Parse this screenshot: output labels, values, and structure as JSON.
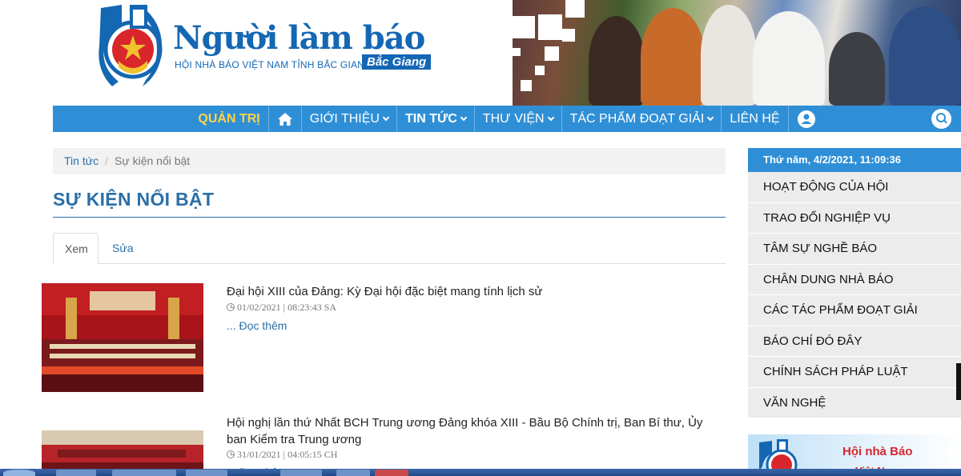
{
  "header": {
    "logo_title": "Người làm báo",
    "logo_subtitle": "HỘI NHÀ BÁO VIỆT NAM TỈNH BẮC GIANG",
    "logo_badge": "Bắc Giang"
  },
  "nav": {
    "admin": "QUẢN TRỊ",
    "items": [
      {
        "label": "GIỚI THIỆU"
      },
      {
        "label": "TIN TỨC"
      },
      {
        "label": "THƯ VIỆN"
      },
      {
        "label": "TÁC PHẨM ĐOẠT GIẢI"
      },
      {
        "label": "LIÊN HỆ"
      }
    ]
  },
  "breadcrumb": {
    "root": "Tin tức",
    "current": "Sự kiện nổi bật"
  },
  "page_title": "SỰ KIỆN NỔI BẬT",
  "tabs": {
    "view": "Xem",
    "edit": "Sửa"
  },
  "articles": [
    {
      "title": "Đại hội XIII của Đảng: Kỳ Đại hội đặc biệt mang tính lịch sử",
      "date": "01/02/2021 | 08:23:43 SA",
      "read_more": "... Đọc thêm"
    },
    {
      "title": "Hội nghị lần thứ Nhất BCH Trung ương Đảng khóa XIII - Bầu Bộ Chính trị, Ban Bí thư, Ủy ban Kiểm tra Trung ương",
      "date": "31/01/2021 | 04:05:15 CH",
      "read_more": "... Đọc thêm"
    }
  ],
  "sidebar": {
    "datetime": "Thứ năm, 4/2/2021, 11:09:36",
    "items": [
      {
        "label": "HOẠT ĐỘNG CỦA HỘI"
      },
      {
        "label": "TRAO ĐỔI NGHIỆP VỤ"
      },
      {
        "label": "TÂM SỰ NGHỀ BÁO"
      },
      {
        "label": "CHÂN DUNG NHÀ BÁO"
      },
      {
        "label": "CÁC TÁC PHẨM ĐOẠT GIẢI"
      },
      {
        "label": "BÁO CHÍ ĐÓ ĐÂY"
      },
      {
        "label": "CHÍNH SÁCH PHÁP LUẬT"
      },
      {
        "label": "VĂN NGHỆ"
      }
    ],
    "banner_text": "Hội nhà Báo",
    "banner_text2": "Việt Nam"
  },
  "colors": {
    "brand_blue": "#1467b3",
    "nav_blue": "#2f8fd6",
    "admin_yellow": "#ffd24a",
    "link_blue": "#2a6fa8"
  }
}
